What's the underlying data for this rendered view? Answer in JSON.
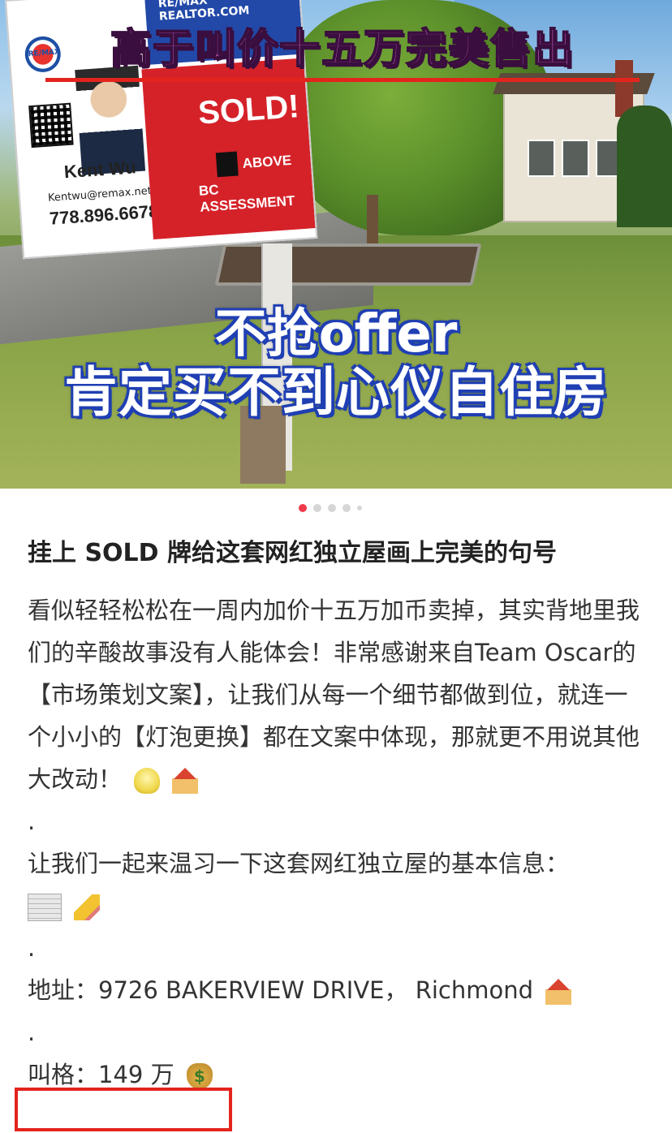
{
  "photo": {
    "banner_top": "高于叫价十五万完美售出",
    "overlay_line1": "不抢offer",
    "overlay_line2": "肯定买不到心仪自住房",
    "sign": {
      "brand": "RE/MAX",
      "top_text": "RE/MAX REALTOR.COM",
      "agent_name": "Kent Wu",
      "agent_email": "Kentwu@remax.net",
      "agent_phone": "778.896.6678",
      "sold": "SOLD!",
      "above": "ABOVE",
      "assessment": "BC ASSESSMENT"
    }
  },
  "carousel": {
    "count": 5,
    "active_index": 0
  },
  "post": {
    "title": "挂上 SOLD 牌给这套网红独立屋画上完美的句号",
    "paragraph1": "看似轻轻松松在一周内加价十五万加币卖掉，其实背地里我们的辛酸故事没有人能体会！非常感谢来自Team Oscar的【市场策划文案】，让我们从每一个细节都做到位，就连一个小小的【灯泡更换】都在文案中体现，那就更不用说其他大改动！",
    "sep": ".",
    "paragraph2": "让我们一起来温习一下这套网红独立屋的基本信息：",
    "address_label": "地址：",
    "address_value": "9726 BAKERVIEW DRIVE，  Richmond",
    "price_label": "叫格：",
    "price_value": "149 万"
  },
  "icons": [
    "bulb-icon",
    "house-icon",
    "scroll-icon",
    "pencil-icon",
    "money-bag-icon"
  ],
  "colors": {
    "active_dot": "#ee3a4a",
    "highlight_box": "#e3241d",
    "overlay_outline": "#1f3fb3"
  }
}
